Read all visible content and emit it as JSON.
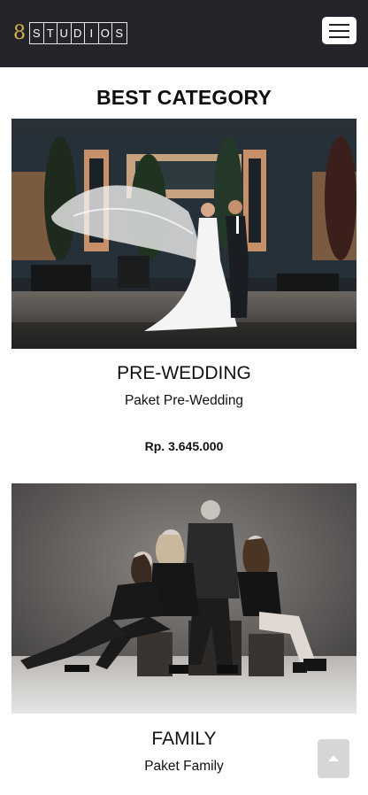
{
  "brand": {
    "digit": "8",
    "letters": [
      "S",
      "T",
      "U",
      "D",
      "I",
      "O",
      "S"
    ]
  },
  "nav": {
    "menu_icon": "hamburger-icon"
  },
  "section": {
    "title": "BEST CATEGORY"
  },
  "cards": [
    {
      "name": "PRE-WEDDING",
      "subtitle": "Paket Pre-Wedding",
      "price": "Rp. 3.645.000"
    },
    {
      "name": "FAMILY",
      "subtitle": "Paket Family"
    }
  ],
  "back_to_top": {
    "icon": "triangle-up-icon"
  },
  "colors": {
    "navbar": "#23252b",
    "brand_gold": "#d4b24c",
    "button_grey": "#d6d6d6"
  }
}
